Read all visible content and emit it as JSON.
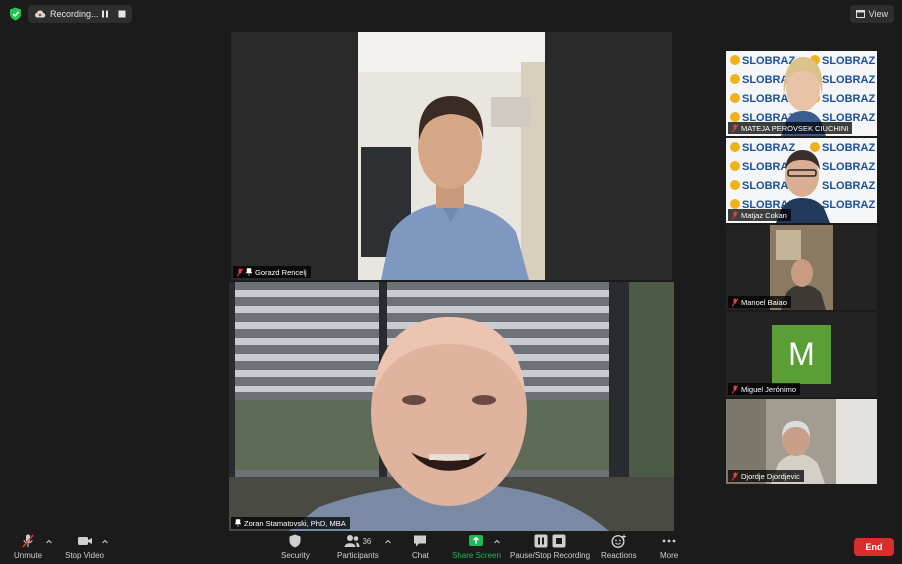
{
  "topbar": {
    "recording_label": "Recording...",
    "view_label": "View"
  },
  "main": {
    "top_speaker_name": "Gorazd Rencelj",
    "bottom_speaker_name": "Zoran Stamatovski, PhD, MBA"
  },
  "gallery": {
    "participants": [
      {
        "name": "MATEJA PEROVSEK CIUCHINI",
        "background_text": "SLOBRAZ"
      },
      {
        "name": "Matjaz Cokan",
        "background_text": "SLOBRAZ"
      },
      {
        "name": "Manoel Baiao"
      },
      {
        "name": "Miguel Jerónimo",
        "avatar_letter": "M",
        "avatar_color": "#5a9f35"
      },
      {
        "name": "Djordje Djordjevic"
      }
    ]
  },
  "toolbar": {
    "unmute": "Unmute",
    "stop_video": "Stop Video",
    "security": "Security",
    "participants": "Participants",
    "participants_count": "36",
    "chat": "Chat",
    "share_screen": "Share Screen",
    "pause_stop_recording": "Pause/Stop Recording",
    "reactions": "Reactions",
    "more": "More",
    "end": "End"
  },
  "colors": {
    "share_green": "#1db954",
    "end_red": "#d92d2b",
    "active_speaker_border": "#d8dd7a",
    "shield_green": "#23c552"
  }
}
